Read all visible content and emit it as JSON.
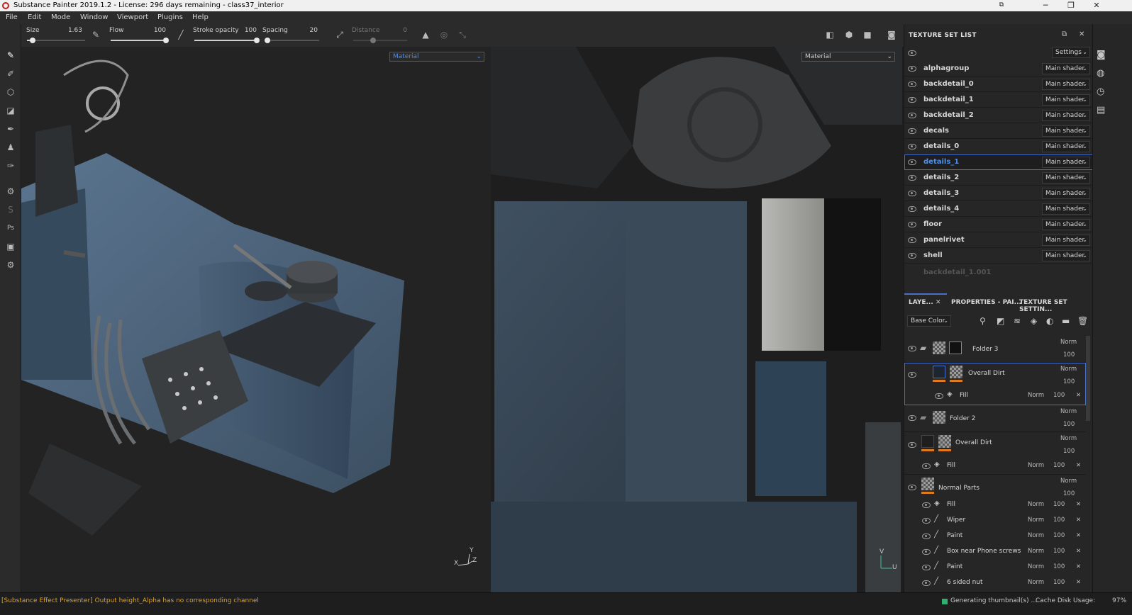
{
  "window": {
    "title": "Substance Painter 2019.1.2 - License: 296 days remaining - class37_interior"
  },
  "menu": [
    "File",
    "Edit",
    "Mode",
    "Window",
    "Viewport",
    "Plugins",
    "Help"
  ],
  "tool_options": {
    "size_label": "Size",
    "size_value": "1.63",
    "flow_label": "Flow",
    "flow_value": "100",
    "stroke_opacity_label": "Stroke opacity",
    "stroke_opacity_value": "100",
    "spacing_label": "Spacing",
    "spacing_value": "20",
    "distance_label": "Distance",
    "distance_value": "0",
    "size_level": 0.1,
    "flow_level": 1.0,
    "opacity_level": 1.0,
    "spacing_level": 0.04,
    "distance_level": 0.0
  },
  "viewport3d": {
    "material_select": "Material",
    "axis_y": "Y",
    "axis_x": "X",
    "axis_z": "Z"
  },
  "viewport2d": {
    "material_select": "Material",
    "axis_v": "V",
    "axis_u": "U"
  },
  "texture_set_list": {
    "title": "TEXTURE SET LIST",
    "settings_label": "Settings",
    "items": [
      {
        "name": "alphagroup",
        "shader": "Main shader"
      },
      {
        "name": "backdetail_0",
        "shader": "Main shader"
      },
      {
        "name": "backdetail_1",
        "shader": "Main shader"
      },
      {
        "name": "backdetail_2",
        "shader": "Main shader"
      },
      {
        "name": "decals",
        "shader": "Main shader"
      },
      {
        "name": "details_0",
        "shader": "Main shader"
      },
      {
        "name": "details_1",
        "shader": "Main shader"
      },
      {
        "name": "details_2",
        "shader": "Main shader"
      },
      {
        "name": "details_3",
        "shader": "Main shader"
      },
      {
        "name": "details_4",
        "shader": "Main shader"
      },
      {
        "name": "floor",
        "shader": "Main shader"
      },
      {
        "name": "panelrivet",
        "shader": "Main shader"
      },
      {
        "name": "shell",
        "shader": "Main shader"
      }
    ],
    "selected": "details_1",
    "disabled_item": "backdetail_1.001"
  },
  "layers_panel": {
    "tabs": [
      "LAYE...",
      "PROPERTIES - PAI...",
      "TEXTURE SET SETTIN..."
    ],
    "channel": "Base Color",
    "layers": [
      {
        "name": "Folder 3",
        "blend": "Norm",
        "opacity": "100"
      },
      {
        "name": "Overall Dirt",
        "blend": "Norm",
        "opacity": "100"
      },
      {
        "name": "Fill",
        "blend": "Norm",
        "opacity": "100"
      },
      {
        "name": "Folder 2",
        "blend": "Norm",
        "opacity": "100"
      },
      {
        "name": "Overall Dirt",
        "blend": "Norm",
        "opacity": "100"
      },
      {
        "name": "Fill",
        "blend": "Norm",
        "opacity": "100"
      },
      {
        "name": "Normal Parts",
        "blend": "Norm",
        "opacity": "100"
      },
      {
        "name": "Fill",
        "blend": "Norm",
        "opacity": "100"
      },
      {
        "name": "Wiper",
        "blend": "Norm",
        "opacity": "100"
      },
      {
        "name": "Paint",
        "blend": "Norm",
        "opacity": "100"
      },
      {
        "name": "Box near Phone screws",
        "blend": "Norm",
        "opacity": "100"
      },
      {
        "name": "Paint",
        "blend": "Norm",
        "opacity": "100"
      },
      {
        "name": "6 sided nut",
        "blend": "Norm",
        "opacity": "100"
      }
    ]
  },
  "status": {
    "message": "[Substance Effect Presenter] Output height_Alpha has no corresponding channel",
    "generating": "Generating thumbnail(s) ...",
    "cache": "Cache Disk Usage:",
    "cache_value": "97%"
  },
  "colors": {
    "accent": "#4a6fc8",
    "mask_bar": "#e07a20",
    "status_warn": "#e0a020"
  }
}
